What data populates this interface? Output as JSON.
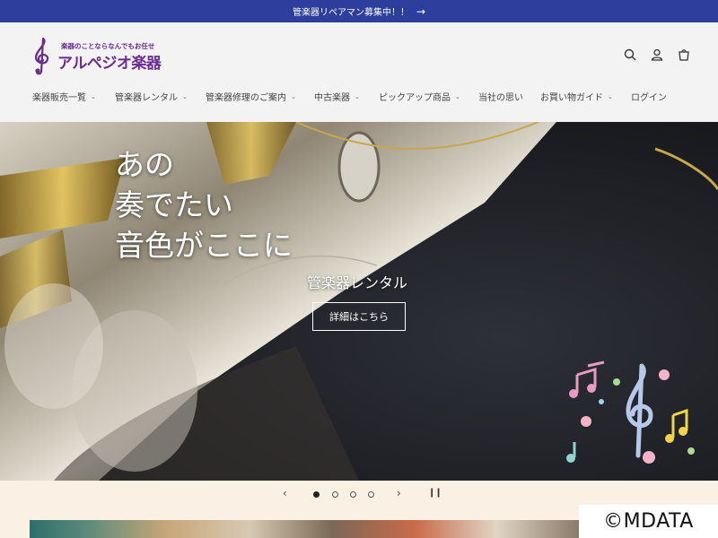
{
  "announcement": {
    "text": "管楽器リペアマン募集中！！",
    "arrow": "→"
  },
  "logo": {
    "tagline": "楽器のことならなんでもお任せ",
    "name": "アルペジオ楽器"
  },
  "header_icons": [
    "search-icon",
    "account-icon",
    "cart-icon"
  ],
  "nav": [
    {
      "label": "楽器販売一覧",
      "has_dropdown": true
    },
    {
      "label": "管楽器レンタル",
      "has_dropdown": true
    },
    {
      "label": "管楽器修理のご案内",
      "has_dropdown": true
    },
    {
      "label": "中古楽器",
      "has_dropdown": true
    },
    {
      "label": "ピックアップ商品",
      "has_dropdown": true
    },
    {
      "label": "当社の思い",
      "has_dropdown": false
    },
    {
      "label": "お買い物ガイド",
      "has_dropdown": true
    },
    {
      "label": "ログイン",
      "has_dropdown": false
    }
  ],
  "hero": {
    "line1": "あの",
    "line2": "奏でたい",
    "line3": "音色がここに",
    "subtitle": "管楽器レンタル",
    "button": "詳細はこちら"
  },
  "slider": {
    "prev": "‹",
    "next": "›",
    "pause": "❙❙",
    "slide_count": 4,
    "active_slide": 1
  },
  "watermark": "©MDATA",
  "colors": {
    "announce_bg": "#2d3e9c",
    "brand_purple": "#6a2c8e",
    "slider_bg": "#faf0e4"
  }
}
